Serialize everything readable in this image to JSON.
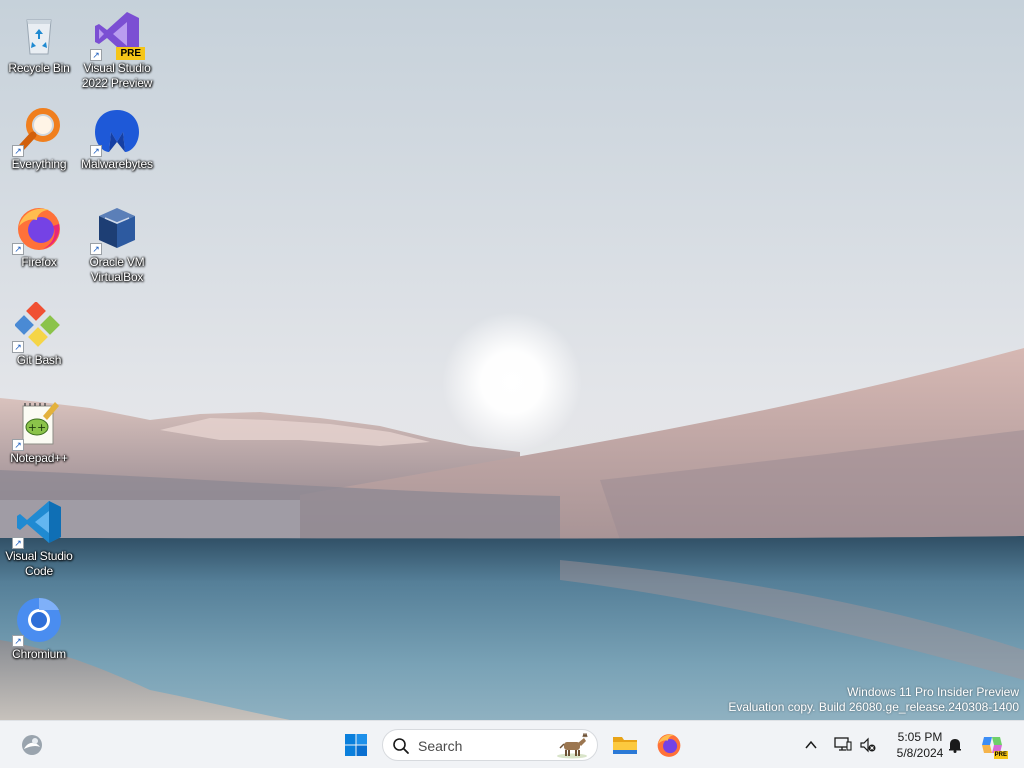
{
  "desktop": {
    "icons": [
      {
        "label": "Recycle Bin",
        "icon": "recycle-bin-icon",
        "shortcut": false
      },
      {
        "label": "Visual Studio 2022 Preview",
        "icon": "visual-studio-preview-icon",
        "shortcut": true,
        "badge": "PRE"
      },
      {
        "label": "Everything",
        "icon": "everything-search-icon",
        "shortcut": true
      },
      {
        "label": "Malwarebytes",
        "icon": "malwarebytes-icon",
        "shortcut": true
      },
      {
        "label": "Firefox",
        "icon": "firefox-icon",
        "shortcut": true
      },
      {
        "label": "Oracle VM VirtualBox",
        "icon": "virtualbox-icon",
        "shortcut": true
      },
      {
        "label": "Git Bash",
        "icon": "git-bash-icon",
        "shortcut": true
      },
      {
        "label": "Notepad++",
        "icon": "notepad-plus-plus-icon",
        "shortcut": true
      },
      {
        "label": "Visual Studio Code",
        "icon": "vscode-icon",
        "shortcut": true
      },
      {
        "label": "Chromium",
        "icon": "chromium-icon",
        "shortcut": true
      }
    ],
    "shortcut_arrow": "↗"
  },
  "watermark": {
    "line1": "Windows 11 Pro Insider Preview",
    "line2": "Evaluation copy. Build 26080.ge_release.240308-1400"
  },
  "taskbar": {
    "widgets_icon": "widgets-icon",
    "start_icon": "windows-start-icon",
    "search": {
      "placeholder": "Search",
      "highlight_icon": "search-highlight-donkey-icon"
    },
    "pinned": [
      {
        "name": "File Explorer",
        "icon": "file-explorer-icon"
      },
      {
        "name": "Firefox",
        "icon": "firefox-icon"
      }
    ],
    "tray": {
      "overflow_icon": "chevron-up-icon",
      "network_icon": "network-icon",
      "volume_icon": "volume-muted-icon",
      "time": "5:05 PM",
      "date": "5/8/2024",
      "notification_icon": "bell-icon",
      "copilot_icon": "copilot-icon",
      "copilot_badge": "PRE"
    }
  },
  "colors": {
    "sky_top": "#c9d3dc",
    "sky_horizon": "#e6e7ea",
    "dune": "#cdb1ad",
    "water": "#5f8aa0",
    "taskbar": "#f1f3f6",
    "accent": "#0067c0"
  }
}
